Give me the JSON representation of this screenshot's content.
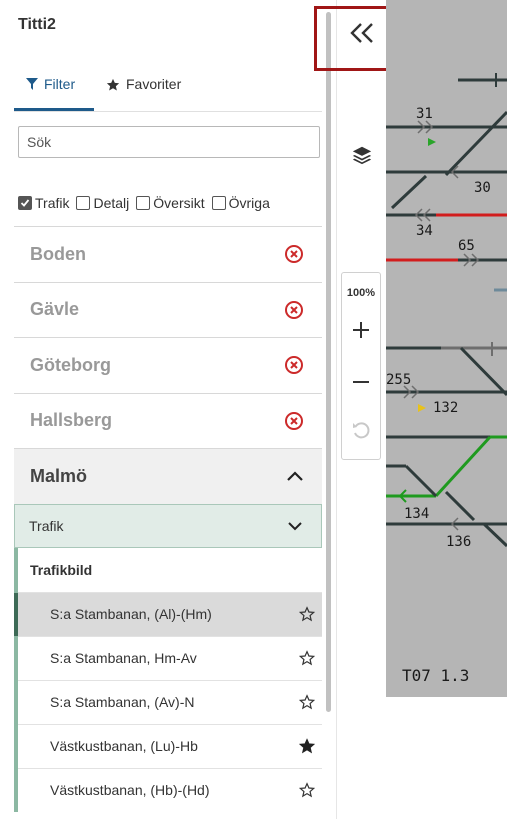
{
  "app": {
    "title": "Titti2"
  },
  "tabs": [
    {
      "label": "Filter",
      "icon": "filter-icon",
      "active": true
    },
    {
      "label": "Favoriter",
      "icon": "star-icon",
      "active": false
    }
  ],
  "search": {
    "placeholder": "Sök",
    "value": ""
  },
  "filters": [
    {
      "label": "Trafik",
      "checked": true
    },
    {
      "label": "Detalj",
      "checked": false
    },
    {
      "label": "Översikt",
      "checked": false
    },
    {
      "label": "Övriga",
      "checked": false
    }
  ],
  "locations": [
    {
      "label": "Boden",
      "state": "collapsed",
      "icon": "remove-icon"
    },
    {
      "label": "Gävle",
      "state": "collapsed",
      "icon": "remove-icon"
    },
    {
      "label": "Göteborg",
      "state": "collapsed",
      "icon": "remove-icon"
    },
    {
      "label": "Hallsberg",
      "state": "collapsed",
      "icon": "remove-icon"
    },
    {
      "label": "Malmö",
      "state": "expanded",
      "icon": "chevron-up-icon"
    }
  ],
  "malmo": {
    "sub_label": "Trafik",
    "group_label": "Trafikbild",
    "routes": [
      {
        "label": "S:a Stambanan, (Al)-(Hm)",
        "favorite": false,
        "selected": true
      },
      {
        "label": "S:a Stambanan, Hm-Av",
        "favorite": false,
        "selected": false
      },
      {
        "label": "S:a Stambanan, (Av)-N",
        "favorite": false,
        "selected": false
      },
      {
        "label": "Västkustbanan, (Lu)-Hb",
        "favorite": true,
        "selected": false
      },
      {
        "label": "Västkustbanan, (Hb)-(Hd)",
        "favorite": false,
        "selected": false
      }
    ]
  },
  "toolbar": {
    "zoom_label": "100%"
  },
  "map": {
    "labels": [
      "31",
      "30",
      "34",
      "65",
      "255",
      "132",
      "134",
      "136"
    ],
    "footer": "T07 1.3"
  },
  "colors": {
    "accent": "#1e5a8a",
    "remove": "#cc2a2a",
    "track": "#2e3b3b",
    "track_red": "#d21d1d",
    "track_green": "#1f9a1f",
    "map_bg": "#b5b5b5",
    "highlight": "#a01616"
  }
}
